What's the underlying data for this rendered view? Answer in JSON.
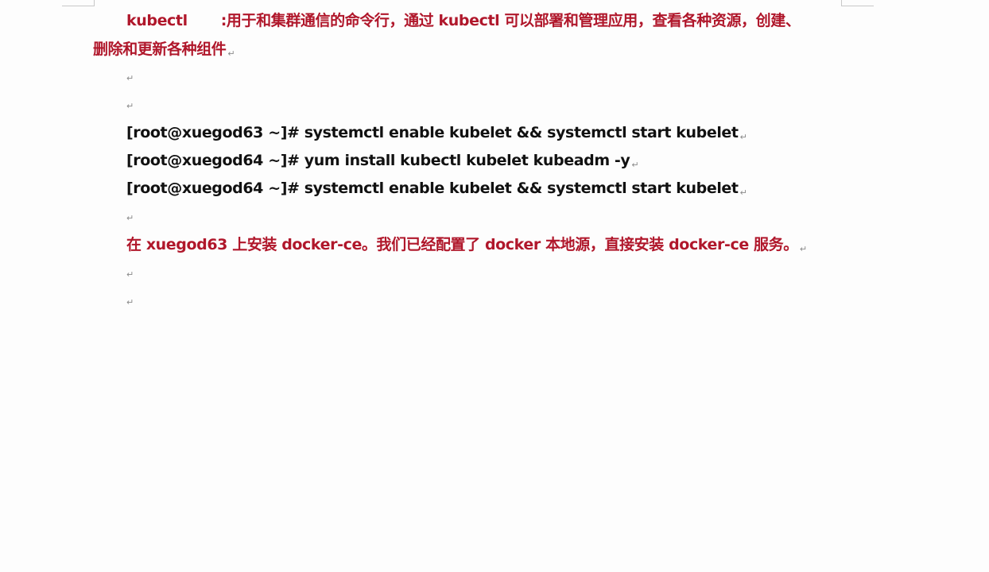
{
  "paragraph_mark": "↵",
  "intro": {
    "term": "kubectl",
    "line1": ":用于和集群通信的命令行，通过 kubectl 可以部署和管理应用，查看各种资源，创建、",
    "line2": "删除和更新各种组件"
  },
  "commands": [
    "[root@xuegod63  ~]# systemctl  enable kubelet  &&  systemctl  start kubelet",
    "[root@xuegod64  ~]# yum install kubectl kubelet kubeadm  -y",
    "[root@xuegod64  ~]# systemctl  enable kubelet  &&  systemctl  start kubelet"
  ],
  "note": "在 xuegod63 上安装 docker-ce。我们已经配置了 docker 本地源，直接安装 docker-ce 服务。",
  "colors": {
    "accent_red": "#b0172b",
    "text_black": "#111111",
    "paragraph_mark": "#8a8a8a"
  }
}
